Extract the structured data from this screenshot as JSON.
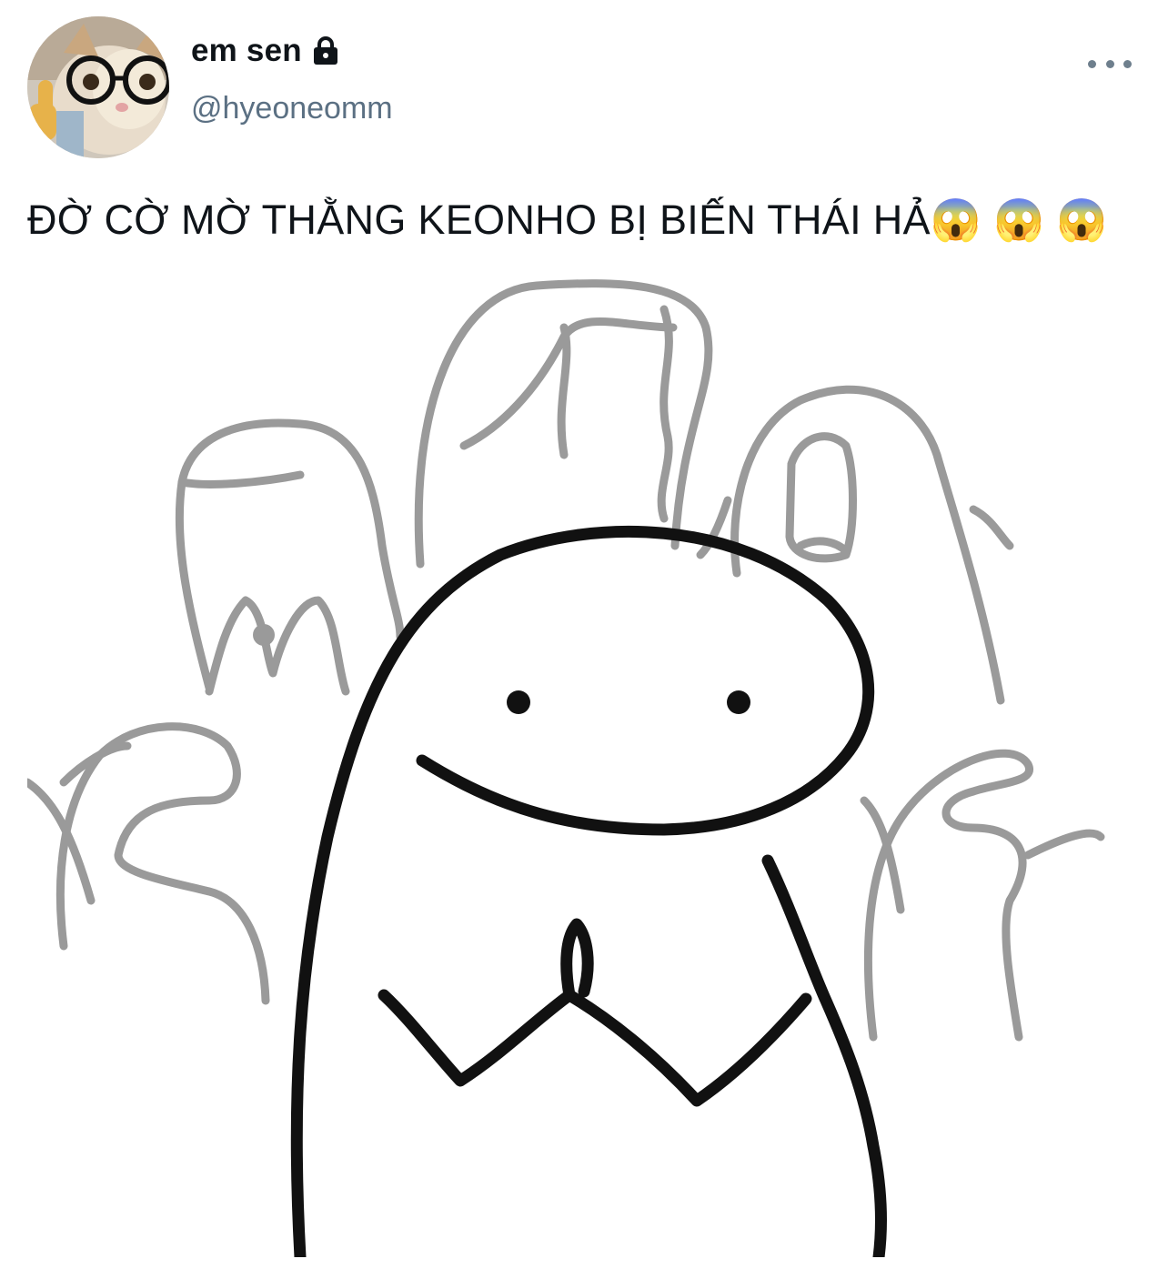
{
  "tweet": {
    "author": {
      "display_name": "em sen",
      "handle": "@hyeoneomm",
      "protected_icon": "lock-icon",
      "avatar_icon": "cat-with-glasses-avatar"
    },
    "more_icon": "more-horizontal-icon",
    "text": "ĐỜ CỜ MỜ THẰNG KEONHO BỊ BIẾN THÁI HẢ😱 😱 😱",
    "media": {
      "kind": "meme-drawing",
      "ink_color": "#111111",
      "background_figures_color": "#9a9a9a"
    }
  }
}
